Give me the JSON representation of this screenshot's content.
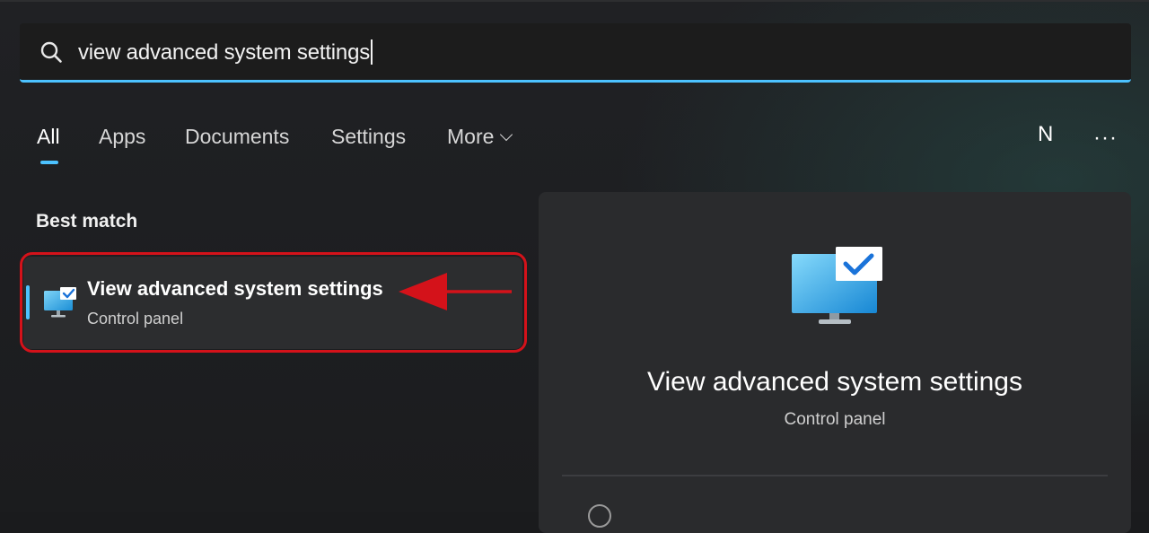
{
  "search": {
    "query": "view advanced system settings"
  },
  "tabs": [
    {
      "label": "All",
      "active": true
    },
    {
      "label": "Apps",
      "active": false
    },
    {
      "label": "Documents",
      "active": false
    },
    {
      "label": "Settings",
      "active": false
    },
    {
      "label": "More",
      "active": false,
      "icon": "chevron-down-icon"
    }
  ],
  "header_right": {
    "avatar_initial": "N",
    "overflow_menu": "···"
  },
  "best_match": {
    "section_label": "Best match",
    "item": {
      "title": "View advanced system settings",
      "subtitle": "Control panel",
      "icon": "monitor-checkmark-icon"
    }
  },
  "preview": {
    "title": "View advanced system settings",
    "subtitle": "Control panel",
    "icon": "monitor-checkmark-icon"
  },
  "colors": {
    "accent": "#4cc2ff",
    "annotation": "#d4121a",
    "background": "#1e1f22",
    "panel": "#2a2b2d"
  }
}
